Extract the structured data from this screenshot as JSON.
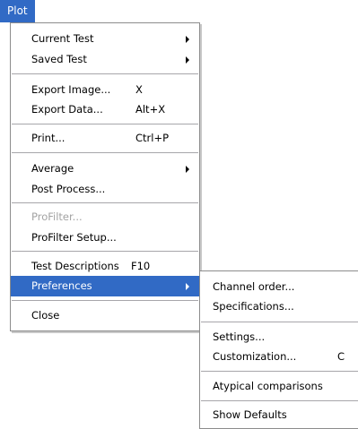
{
  "menubar": {
    "plot_label": "Plot"
  },
  "main_menu": {
    "current_test": "Current Test",
    "saved_test": "Saved Test",
    "export_image": "Export Image...",
    "export_image_shortcut": "X",
    "export_data": "Export Data...",
    "export_data_shortcut": "Alt+X",
    "print": "Print...",
    "print_shortcut": "Ctrl+P",
    "average": "Average",
    "post_process": "Post Process...",
    "profilter": "ProFilter...",
    "profilter_setup": "ProFilter Setup...",
    "test_descriptions": "Test Descriptions",
    "test_descriptions_shortcut": "F10",
    "preferences": "Preferences",
    "close": "Close"
  },
  "submenu": {
    "channel_order": "Channel order...",
    "specifications": "Specifications...",
    "settings": "Settings...",
    "customization": "Customization...",
    "customization_shortcut": "C",
    "atypical_comparisons": "Atypical comparisons",
    "show_defaults": "Show Defaults"
  }
}
